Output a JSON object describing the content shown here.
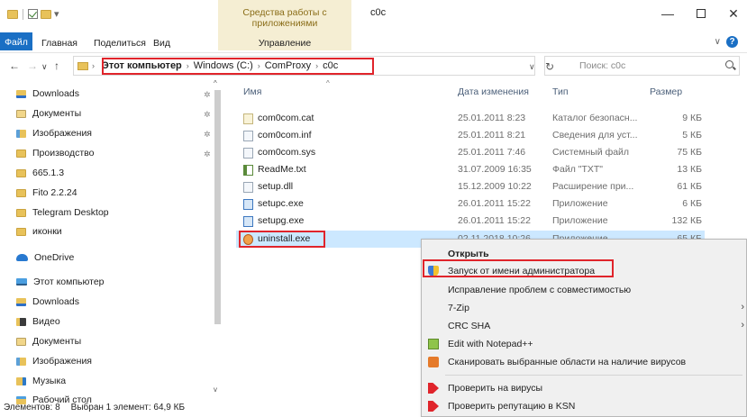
{
  "window": {
    "title": "c0c",
    "context_tool_label": "Средства работы с приложениями",
    "minimize": "—",
    "maximize": "",
    "close": "✕"
  },
  "ribbon": {
    "tabs": [
      "Файл",
      "Главная",
      "Поделиться",
      "Вид",
      "Управление"
    ],
    "collapse": "∨",
    "help": "?"
  },
  "address": {
    "back": "←",
    "forward": "→",
    "recent": "∨",
    "up": "↑",
    "crumbs": [
      "Этот компьютер",
      "Windows (C:)",
      "ComProxy",
      "c0c"
    ],
    "dropdown": "∨",
    "refresh": "↻",
    "search_placeholder": "Поиск: c0c"
  },
  "nav": {
    "items": [
      {
        "label": "Downloads",
        "icon": "downloads-icon",
        "pinned": true
      },
      {
        "label": "Документы",
        "icon": "documents-icon",
        "pinned": true
      },
      {
        "label": "Изображения",
        "icon": "pictures-icon",
        "pinned": true
      },
      {
        "label": "Производство",
        "icon": "folder-icon",
        "pinned": true
      },
      {
        "label": "665.1.3",
        "icon": "folder-icon",
        "pinned": false
      },
      {
        "label": "Fito 2.2.24",
        "icon": "folder-icon",
        "pinned": false
      },
      {
        "label": "Telegram Desktop",
        "icon": "folder-icon",
        "pinned": false
      },
      {
        "label": "иконки",
        "icon": "folder-icon",
        "pinned": false
      },
      {
        "label": "OneDrive",
        "icon": "onedrive-icon",
        "pinned": false
      },
      {
        "label": "Этот компьютер",
        "icon": "this-pc-icon",
        "pinned": false
      },
      {
        "label": "Downloads",
        "icon": "downloads-icon",
        "pinned": false
      },
      {
        "label": "Видео",
        "icon": "videos-icon",
        "pinned": false
      },
      {
        "label": "Документы",
        "icon": "documents-icon",
        "pinned": false
      },
      {
        "label": "Изображения",
        "icon": "pictures-icon",
        "pinned": false
      },
      {
        "label": "Музыка",
        "icon": "music-icon",
        "pinned": false
      },
      {
        "label": "Рабочий стол",
        "icon": "desktop-icon",
        "pinned": false
      }
    ],
    "pin_glyph": "✲"
  },
  "files": {
    "columns": {
      "name": "Имя",
      "date": "Дата изменения",
      "type": "Тип",
      "size": "Размер"
    },
    "sort_glyph": "^",
    "rows": [
      {
        "name": "com0com.cat",
        "date": "25.01.2011 8:23",
        "type": "Каталог безопасн...",
        "size": "9 КБ",
        "icon": "cat-file-icon"
      },
      {
        "name": "com0com.inf",
        "date": "25.01.2011 8:21",
        "type": "Сведения для уст...",
        "size": "5 КБ",
        "icon": "inf-file-icon"
      },
      {
        "name": "com0com.sys",
        "date": "25.01.2011 7:46",
        "type": "Системный файл",
        "size": "75 КБ",
        "icon": "sys-file-icon"
      },
      {
        "name": "ReadMe.txt",
        "date": "31.07.2009 16:35",
        "type": "Файл \"TXT\"",
        "size": "13 КБ",
        "icon": "txt-file-icon"
      },
      {
        "name": "setup.dll",
        "date": "15.12.2009 10:22",
        "type": "Расширение при...",
        "size": "61 КБ",
        "icon": "dll-file-icon"
      },
      {
        "name": "setupc.exe",
        "date": "26.01.2011 15:22",
        "type": "Приложение",
        "size": "6 КБ",
        "icon": "exe-file-icon"
      },
      {
        "name": "setupg.exe",
        "date": "26.01.2011 15:22",
        "type": "Приложение",
        "size": "132 КБ",
        "icon": "exe-file-icon"
      },
      {
        "name": "uninstall.exe",
        "date": "02.11.2018 10:26",
        "type": "Приложение",
        "size": "65 КБ",
        "icon": "uninstall-exe-icon"
      }
    ]
  },
  "context_menu": {
    "items": [
      {
        "label": "Открыть",
        "bold": true,
        "icon": "",
        "submenu": false
      },
      {
        "label": "Запуск от имени администратора",
        "bold": false,
        "icon": "shield-icon",
        "submenu": false
      },
      {
        "label": "Исправление проблем с совместимостью",
        "bold": false,
        "icon": "",
        "submenu": false
      },
      {
        "label": "7-Zip",
        "bold": false,
        "icon": "",
        "submenu": true
      },
      {
        "label": "CRC SHA",
        "bold": false,
        "icon": "",
        "submenu": true
      },
      {
        "label": "Edit with Notepad++",
        "bold": false,
        "icon": "notepad-plus-plus-icon",
        "submenu": false
      },
      {
        "label": "Сканировать выбранные области на наличие вирусов",
        "bold": false,
        "icon": "scan-icon",
        "submenu": false
      },
      {
        "label": "Проверить на вирусы",
        "bold": false,
        "icon": "kaspersky-icon",
        "submenu": false
      },
      {
        "label": "Проверить репутацию в KSN",
        "bold": false,
        "icon": "kaspersky-icon",
        "submenu": false
      }
    ],
    "submenu_glyph": "›"
  },
  "status": {
    "count": "Элементов: 8",
    "selection": "Выбран 1 элемент: 64,9 КБ"
  },
  "colors": {
    "accent": "#1a6fc4",
    "highlight_box": "#e0242b",
    "selection": "#cce8ff",
    "context_tool_bg": "#f5eed3"
  }
}
